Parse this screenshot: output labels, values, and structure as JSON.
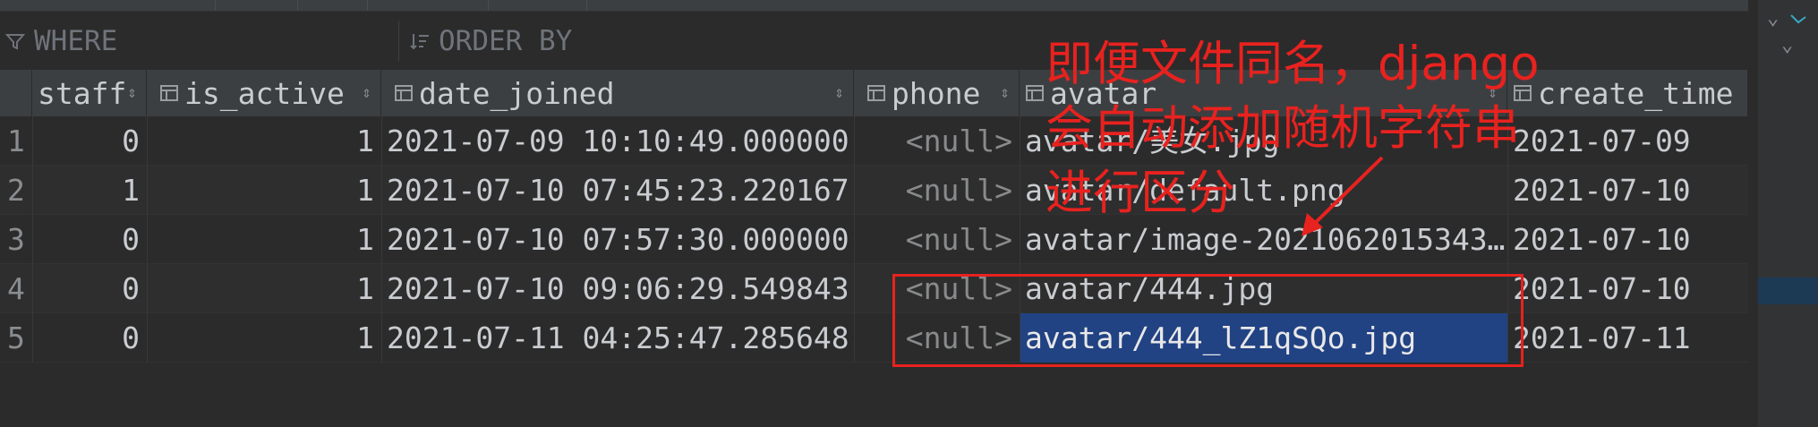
{
  "filter": {
    "where_label": "WHERE",
    "orderby_label": "ORDER BY",
    "where_icon": "filter-icon",
    "orderby_icon": "sort-lines-icon"
  },
  "columns": [
    {
      "name": "staff",
      "icon": "column-icon",
      "sort_icon": "sort-updown-icon"
    },
    {
      "name": "is_active",
      "icon": "column-icon",
      "sort_icon": "sort-updown-icon"
    },
    {
      "name": "date_joined",
      "icon": "column-icon",
      "sort_icon": "sort-updown-icon"
    },
    {
      "name": "phone",
      "icon": "column-icon",
      "sort_icon": "sort-updown-icon"
    },
    {
      "name": "avatar",
      "icon": "column-icon",
      "sort_icon": "sort-updown-icon"
    },
    {
      "name": "create_time",
      "icon": "column-icon",
      "sort_icon": ""
    }
  ],
  "rows": [
    {
      "num": "1",
      "staff": "0",
      "is_active": "1",
      "date_joined": "2021-07-09 10:10:49.000000",
      "phone": "<null>",
      "avatar": "avatar/美女.jpg",
      "create_time": "2021-07-09"
    },
    {
      "num": "2",
      "staff": "1",
      "is_active": "1",
      "date_joined": "2021-07-10 07:45:23.220167",
      "phone": "<null>",
      "avatar": "avatar/default.png",
      "create_time": "2021-07-10"
    },
    {
      "num": "3",
      "staff": "0",
      "is_active": "1",
      "date_joined": "2021-07-10 07:57:30.000000",
      "phone": "<null>",
      "avatar": "avatar/image-2021062015343…",
      "create_time": "2021-07-10"
    },
    {
      "num": "4",
      "staff": "0",
      "is_active": "1",
      "date_joined": "2021-07-10 09:06:29.549843",
      "phone": "<null>",
      "avatar": "avatar/444.jpg",
      "create_time": "2021-07-10"
    },
    {
      "num": "5",
      "staff": "0",
      "is_active": "1",
      "date_joined": "2021-07-11 04:25:47.285648",
      "phone": "<null>",
      "avatar": "avatar/444_lZ1qSQo.jpg",
      "create_time": "2021-07-11"
    }
  ],
  "selection": {
    "row": 5,
    "column": "avatar"
  },
  "annotation": {
    "lines": [
      "即便文件同名，django",
      "会自动添加随机字符串",
      "进行区分"
    ],
    "color": "#e8221f"
  },
  "right_panel": {
    "icons": [
      "chevron-down-icon",
      "chevron-down-icon",
      "structure-icon"
    ]
  },
  "colors": {
    "background": "#2b2b2b",
    "header": "#3c3f41",
    "selection": "#214283",
    "null_text": "#888a8c"
  }
}
